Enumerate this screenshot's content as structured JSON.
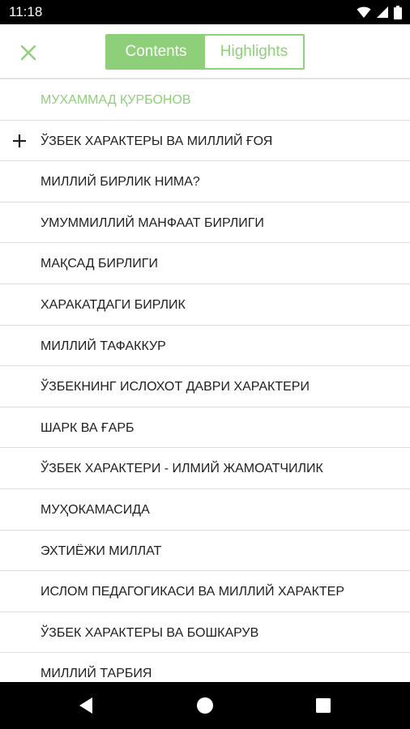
{
  "status_bar": {
    "time": "11:18",
    "icons": [
      "wifi-icon",
      "cellular-signal-icon",
      "battery-icon"
    ]
  },
  "toolbar": {
    "close_icon": "close-icon",
    "tabs": [
      {
        "label": "Contents",
        "active": true
      },
      {
        "label": "Highlights",
        "active": false
      }
    ]
  },
  "contents": {
    "items": [
      {
        "label": "МУХАММАД ҚУРБОНОВ",
        "type": "author"
      },
      {
        "label": "ЎЗБЕК ХАРАКТЕРЫ ВА МИЛЛИЙ ҒОЯ",
        "expandable": true
      },
      {
        "label": "МИЛЛИЙ БИРЛИК НИМА?"
      },
      {
        "label": "УМУММИЛЛИЙ МАНФААТ БИРЛИГИ"
      },
      {
        "label": "МАҚСАД БИРЛИГИ"
      },
      {
        "label": "ХАРАКАТДАГИ БИРЛИК"
      },
      {
        "label": "МИЛЛИЙ ТАФАККУР"
      },
      {
        "label": "ЎЗБЕКНИНГ ИСЛОХОТ ДАВРИ ХАРАКТЕРИ"
      },
      {
        "label": "ШАРК ВА ҒАРБ"
      },
      {
        "label": "ЎЗБЕК ХАРАКТЕРИ - ИЛМИЙ ЖАМОАТЧИЛИК"
      },
      {
        "label": "МУҲОКАМАСИДА"
      },
      {
        "label": "ЭХТИЁЖИ МИЛЛАТ"
      },
      {
        "label": "ИСЛОМ ПЕДАГОГИКАСИ ВА МИЛЛИЙ ХАРАКТЕР"
      },
      {
        "label": "ЎЗБЕК ХАРАКТЕРЫ ВА БОШКАРУВ"
      },
      {
        "label": "МИЛЛИЙ ТАРБИЯ"
      }
    ]
  },
  "nav_bar": {
    "buttons": [
      "back-icon",
      "home-icon",
      "recents-icon"
    ]
  },
  "colors": {
    "accent": "#8ed07a",
    "text": "#1f1f1f",
    "divider": "#dddddd",
    "system_bar": "#000000"
  }
}
